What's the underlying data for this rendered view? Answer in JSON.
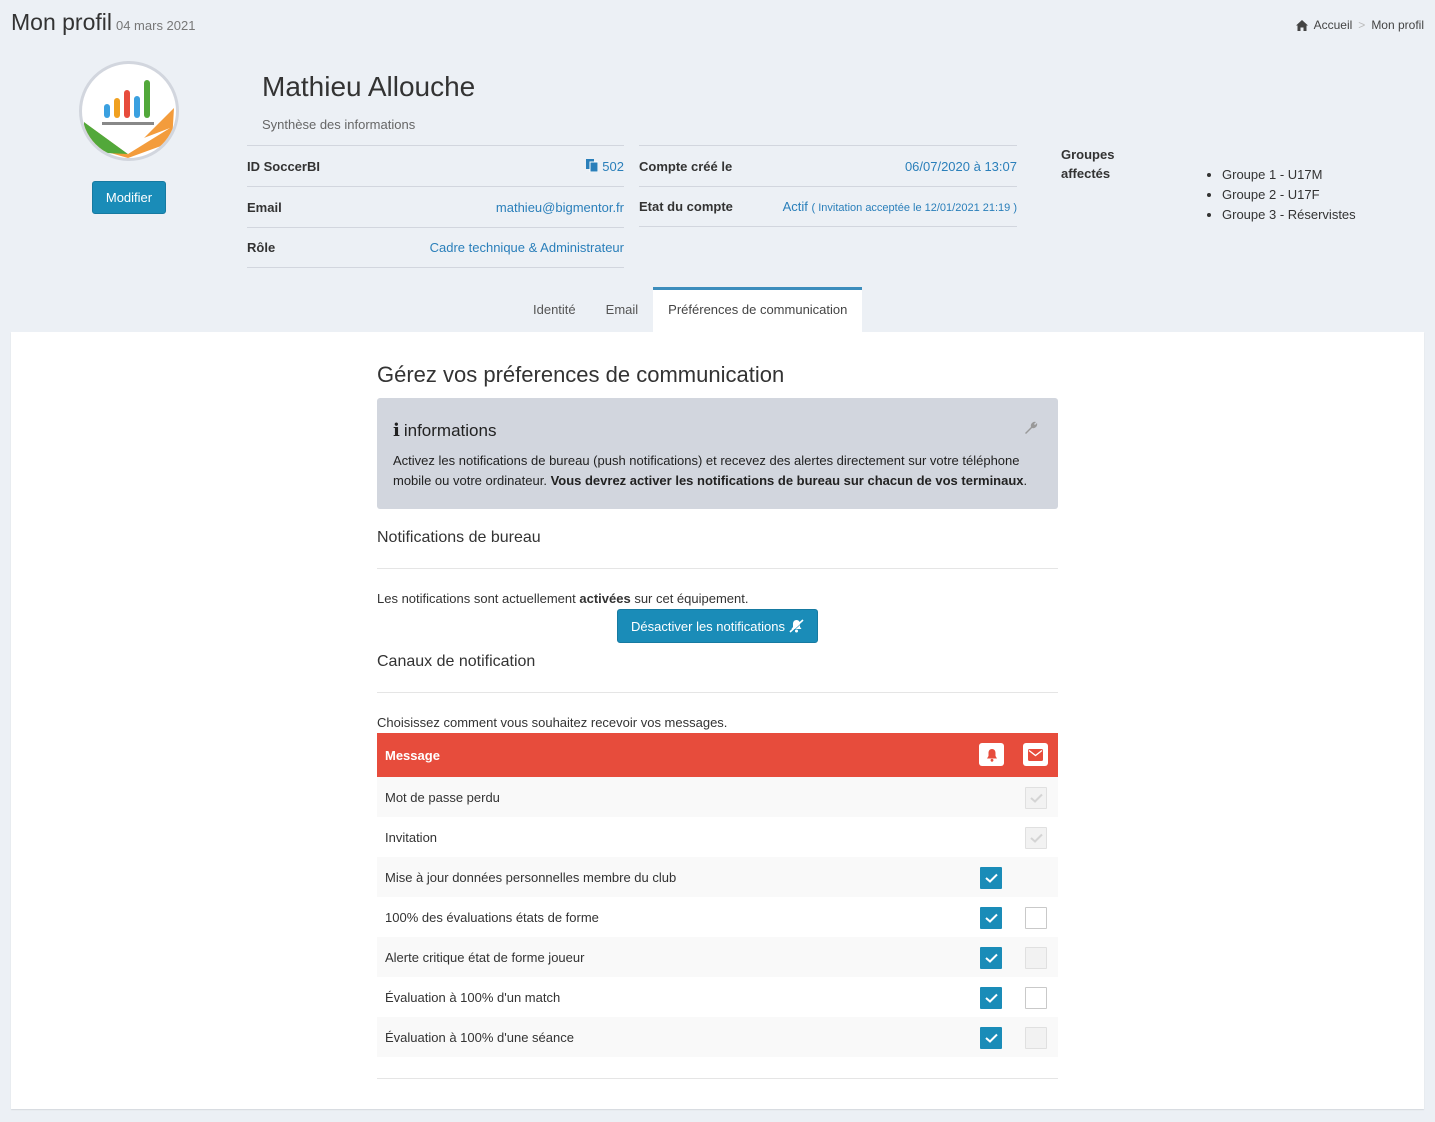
{
  "page": {
    "title": "Mon profil",
    "date": "04 mars 2021"
  },
  "breadcrumb": {
    "home": "Accueil",
    "current": "Mon profil"
  },
  "profile": {
    "edit_label": "Modifier",
    "name": "Mathieu Allouche",
    "subtitle": "Synthèse des informations",
    "id_label": "ID SoccerBI",
    "id_value": "502",
    "email_label": "Email",
    "email_value": "mathieu@bigmentor.fr",
    "role_label": "Rôle",
    "role_value": "Cadre technique & Administrateur",
    "created_label": "Compte créé le",
    "created_value": "06/07/2020 à 13:07",
    "status_label": "Etat du compte",
    "status_value": "Actif",
    "status_detail": "( Invitation acceptée le 12/01/2021 21:19 )",
    "groups_label": "Groupes affectés",
    "groups": [
      "Groupe 1 - U17M",
      "Groupe 2 - U17F",
      "Groupe 3 - Réservistes"
    ]
  },
  "tabs": [
    {
      "label": "Identité",
      "active": false
    },
    {
      "label": "Email",
      "active": false
    },
    {
      "label": "Préférences de communication",
      "active": true
    }
  ],
  "prefs": {
    "title": "Gérez vos préferences de communication",
    "info_title": "informations",
    "info_text": "Activez les notifications de bureau (push notifications) et recevez des alertes directement sur votre téléphone mobile ou votre ordinateur.",
    "info_bold": "Vous devrez activer les notifications de bureau sur chacun de vos terminaux",
    "info_end": ".",
    "desktop_title": "Notifications de bureau",
    "status_pre": "Les notifications sont actuellement",
    "status_bold": "activées",
    "status_post": "sur cet équipement.",
    "deactivate_label": "Désactiver les notifications",
    "channels_title": "Canaux de notification",
    "channels_text": "Choisissez comment vous souhaitez recevoir vos messages.",
    "table_header": "Message",
    "accent_color": "#e74c3c",
    "primary_color": "#1a8cb8",
    "rows": [
      {
        "label": "Mot de passe perdu",
        "push": null,
        "mail": "disabled-checked"
      },
      {
        "label": "Invitation",
        "push": null,
        "mail": "disabled-checked"
      },
      {
        "label": "Mise à jour données personnelles membre du club",
        "push": "checked",
        "mail": null
      },
      {
        "label": "100% des évaluations états de forme",
        "push": "checked",
        "mail": "unchecked"
      },
      {
        "label": "Alerte critique état de forme joueur",
        "push": "checked",
        "mail": "disabled"
      },
      {
        "label": "Évaluation à 100% d'un match",
        "push": "checked",
        "mail": "unchecked"
      },
      {
        "label": "Évaluation à 100% d'une séance",
        "push": "checked",
        "mail": "disabled"
      }
    ]
  }
}
